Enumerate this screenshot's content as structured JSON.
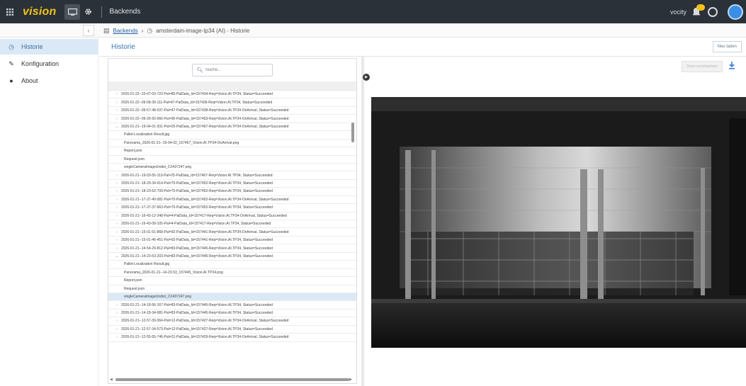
{
  "topbar": {
    "logo": "vision",
    "section_title": "Backends",
    "user": "vocity",
    "accent": "#f2c21a"
  },
  "breadcrumb": {
    "root": "Backends",
    "current": "amsterdam-image-tp34 (AI) - Historie"
  },
  "sidebar": {
    "items": [
      {
        "label": "Historie",
        "icon": "history-icon",
        "active": true
      },
      {
        "label": "Konfiguration",
        "icon": "pencil-icon",
        "active": false
      },
      {
        "label": "About",
        "icon": "info-icon",
        "active": false
      }
    ]
  },
  "main": {
    "title": "Historie",
    "new_button": "Neu laden"
  },
  "search": {
    "placeholder": "Suche..."
  },
  "rows": [
    {
      "text": "2026-01-22--10-07-03-723-Pal=85-PalData_Id=157434-Req=Vision.AI.TP34, Status=Succeeded",
      "type": "parent"
    },
    {
      "text": "2026-01-22--09-58-39-111-Pal=47-PalData_Id=157436-Req=Vision.AI.TP34, Status=Succeeded",
      "type": "parent"
    },
    {
      "text": "2026-01-22--09-57-48-037-Pal=47-PalData_Id=157438-Req=Vision.AI.TP34-OnArrival, Status=Succeeded",
      "type": "parent"
    },
    {
      "text": "2026-01-22--09-26-50-066-Pal=90-PalData_Id=157453-Req=Vision.AI.TP34-OnArrival, Status=Succeeded",
      "type": "parent"
    },
    {
      "text": "2026-01-21--19-04-01-931-Pal=25-PalData_Id=157467-Req=Vision.AI.TP34-OnArrival, Status=Succeeded",
      "type": "expanded"
    },
    {
      "text": "Pallet-Localization Result.jpg",
      "type": "child"
    },
    {
      "text": "Panorama_2026-01-21--19-04-02_157467_Vision.AI.TP34-OnArrival.png",
      "type": "child"
    },
    {
      "text": "Report.json",
      "type": "child"
    },
    {
      "text": "Request.json",
      "type": "child"
    },
    {
      "text": "singleCameraImageUndist_CX437247.png",
      "type": "child"
    },
    {
      "text": "2026-01-21--19-03-55-113-Pal=25-PalData_Id=157467-Req=Vision.AI.TP34, Status=Succeeded",
      "type": "parent"
    },
    {
      "text": "2026-01-21--18-29-34-914-Pal=70-PalData_Id=157452-Req=Vision.AI.TP34, Status=Succeeded",
      "type": "parent"
    },
    {
      "text": "2026-01-21--18-23-52-709-Pal=70-PalData_Id=157452-Req=Vision.AI.TP34, Status=Succeeded",
      "type": "parent"
    },
    {
      "text": "2026-01-21--17-37-40-081-Pal=70-PalData_Id=157452-Req=Vision.AI.TP34-OnArrival, Status=Succeeded",
      "type": "parent"
    },
    {
      "text": "2026-01-21--17-37-37-663-Pal=70-PalData_Id=157452-Req=Vision.AI.TP34, Status=Succeeded",
      "type": "parent"
    },
    {
      "text": "2026-01-21--16-43-12-348-Pal=4-PalData_Id=157417-Req=Vision.AI.TP34-OnArrival, Status=Succeeded",
      "type": "parent"
    },
    {
      "text": "2026-01-21--16-43-09-105-Pal=4-PalData_Id=157417-Req=Vision.AI.TP34, Status=Succeeded",
      "type": "parent"
    },
    {
      "text": "2026-01-21--15-01-51-868-Pal=92-PalData_Id=157441-Req=Vision.AI.TP34-OnArrival, Status=Succeeded",
      "type": "parent"
    },
    {
      "text": "2026-01-21--15-01-46-451-Pal=92-PalData_Id=157441-Req=Vision.AI.TP34, Status=Succeeded",
      "type": "parent"
    },
    {
      "text": "2026-01-21--14-54-29-812-Pal=83-PalData_Id=157445-Req=Vision.AI.TP34, Status=Succeeded",
      "type": "parent"
    },
    {
      "text": "2026-01-21--14-23-53-203-Pal=83-PalData_Id=157445-Req=Vision.AI.TP34, Status=Succeeded",
      "type": "expanded"
    },
    {
      "text": "Pallet-Localization Result.jpg",
      "type": "child"
    },
    {
      "text": "Panorama_2026-01-21--14-23-53_157445_Vision.AI.TP34.png",
      "type": "child"
    },
    {
      "text": "Report.json",
      "type": "child"
    },
    {
      "text": "Request.json",
      "type": "child"
    },
    {
      "text": "singleCameraImageUndist_CX437247.png",
      "type": "child-selected"
    },
    {
      "text": "2026-01-21--14-18-56-167-Pal=83-PalData_Id=157445-Req=Vision.AI.TP34, Status=Succeeded",
      "type": "parent"
    },
    {
      "text": "2026-01-21--14-18-34-081-Pal=83-PalData_Id=157445-Req=Vision.AI.TP34, Status=Succeeded",
      "type": "parent"
    },
    {
      "text": "2026-01-21--12-57-39-364-Pal=12-PalData_Id=157427-Req=Vision.AI.TP34-OnArrival, Status=Succeeded",
      "type": "parent"
    },
    {
      "text": "2026-01-21--12-57-34-573-Pal=12-PalData_Id=157427-Req=Vision.AI.TP34, Status=Succeeded",
      "type": "parent"
    },
    {
      "text": "2026-01-21--12-55-55-746-Pal=21-PalData_Id=157429-Req=Vision.AI.TP34-OnArrival, Status=Succeeded",
      "type": "parent"
    }
  ],
  "preview": {
    "zoom_button": "Zoom zurücksetzen",
    "download_icon": "download-icon"
  }
}
